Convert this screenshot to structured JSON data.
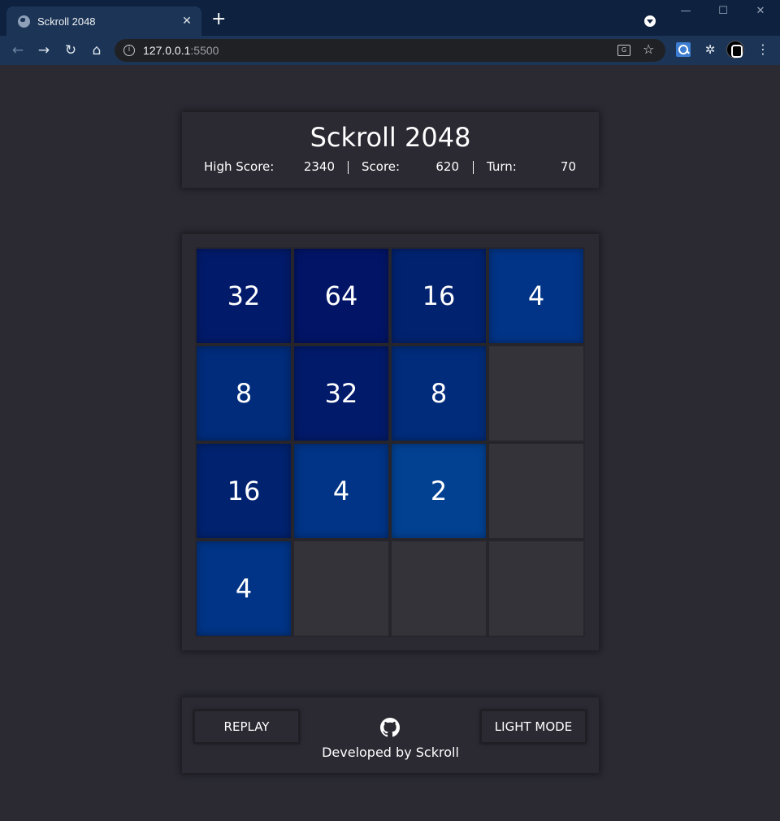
{
  "browser": {
    "tab_title": "Sckroll 2048",
    "tab_close": "✕",
    "new_tab": "+",
    "url_host": "127.0.0.1",
    "url_port": ":5500",
    "window_buttons": [
      "—",
      "☐",
      "✕"
    ]
  },
  "header": {
    "title": "Sckroll 2048",
    "high_score_label": "High Score:",
    "high_score": "2340",
    "score_label": "Score:",
    "score": "620",
    "turn_label": "Turn:",
    "turn": "70"
  },
  "board": {
    "rows": [
      [
        32,
        64,
        16,
        4
      ],
      [
        8,
        32,
        8,
        null
      ],
      [
        16,
        4,
        2,
        null
      ],
      [
        4,
        null,
        null,
        null
      ]
    ],
    "tile_colors": {
      "2": "#024192",
      "4": "#013486",
      "8": "#012c7b",
      "16": "#01226f",
      "32": "#021a6a",
      "64": "#021466",
      "empty": "#34333a"
    }
  },
  "footer": {
    "replay_label": "REPLAY",
    "mode_label": "LIGHT MODE",
    "developer_text": "Developed by Sckroll",
    "github_icon": "github-icon"
  }
}
